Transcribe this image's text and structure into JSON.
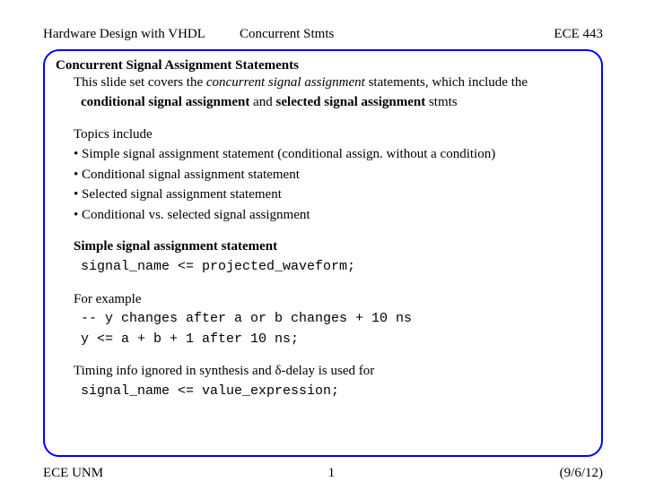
{
  "header": {
    "left1": "Hardware Design with VHDL",
    "left2": "Concurrent Stmts",
    "right": "ECE 443"
  },
  "title": "Concurrent Signal Assignment Statements",
  "intro": {
    "pre": "This slide set covers the ",
    "em": "concurrent signal assignment",
    "post": " statements, which include the"
  },
  "intro2": {
    "b1": "conditional signal assignment",
    "mid": " and ",
    "b2": "selected signal assignment",
    "post": " stmts"
  },
  "topics_label": "Topics include",
  "bullets": [
    "• Simple signal assignment statement (conditional assign. without a condition)",
    "• Conditional signal assignment statement",
    "• Selected signal assignment statement",
    "• Conditional vs. selected signal assignment"
  ],
  "section2": "Simple signal assignment statement",
  "code1": "signal_name <= projected_waveform;",
  "example_label": "For example",
  "code2": "-- y changes after a or b changes + 10 ns",
  "code3": "y <= a + b + 1 after 10 ns;",
  "timing": "Timing info ignored in synthesis and δ-delay is used for",
  "code4": "signal_name <= value_expression;",
  "footer": {
    "left": "ECE UNM",
    "center": "1",
    "right": "(9/6/12)"
  }
}
